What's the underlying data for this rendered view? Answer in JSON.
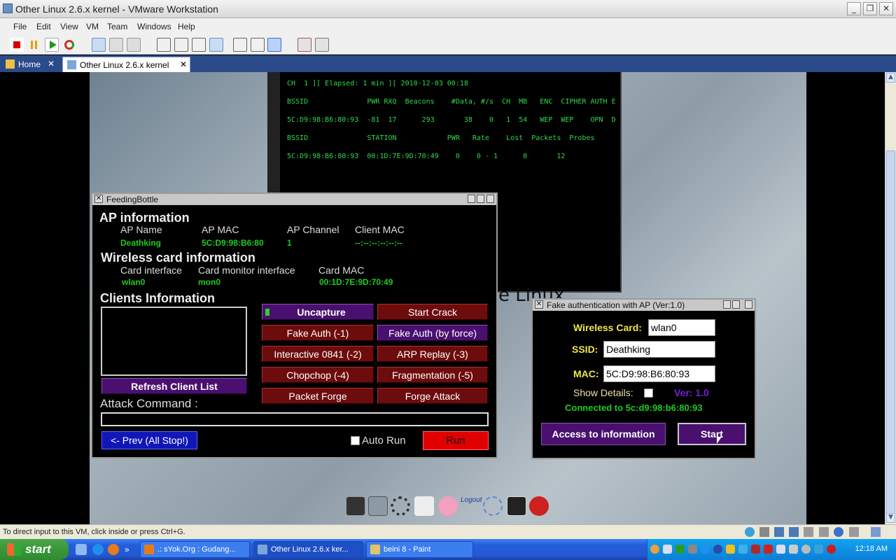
{
  "window": {
    "title": "Other Linux 2.6.x kernel - VMware Workstation"
  },
  "menu": [
    "File",
    "Edit",
    "View",
    "VM",
    "Team",
    "Windows",
    "Help"
  ],
  "tabs": [
    {
      "label": "Home"
    },
    {
      "label": "Other Linux 2.6.x kernel"
    }
  ],
  "terminal": {
    "lines": [
      "CH  1 ][ Elapsed: 1 min ][ 2010-12-03 00:18",
      "BSSID              PWR RXQ  Beacons    #Data, #/s  CH  MB   ENC  CIPHER AUTH E",
      "5C:D9:98:B6:80:93  -81  17      293       38    0   1  54   WEP  WEP    OPN  D",
      "BSSID              STATION            PWR   Rate    Lost  Packets  Probes",
      "5C:D9:98:B6:80:93  00:1D:7E:9D:70:49    0    0 - 1      0       12"
    ]
  },
  "background_text": "e Linux",
  "feedingbottle": {
    "title": "FeedingBottle",
    "ap_heading": "AP information",
    "ap_name_label": "AP Name",
    "ap_mac_label": "AP MAC",
    "ap_channel_label": "AP Channel",
    "client_mac_label": "Client MAC",
    "ap_name": "Deathking",
    "ap_mac": "5C:D9:98:B6:80",
    "ap_channel": "1",
    "client_mac": "--:--:--:--:--:--",
    "card_heading": "Wireless card information",
    "card_interface_label": "Card interface",
    "card_monitor_label": "Card monitor interface",
    "card_mac_label": "Card MAC",
    "card_interface": "wlan0",
    "card_monitor": "mon0",
    "card_mac": "00:1D:7E:9D:70:49",
    "clients_heading": "Clients Information",
    "refresh_label": "Refresh Client List",
    "uncapture_label": "Uncapture",
    "start_crack_label": "Start Crack",
    "fake_auth_label": "Fake Auth  (-1)",
    "fake_auth_force_label": "Fake Auth (by force)",
    "interactive_label": "Interactive 0841  (-2)",
    "arp_replay_label": "ARP Replay  (-3)",
    "chopchop_label": "Chopchop (-4)",
    "fragmentation_label": "Fragmentation (-5)",
    "packet_forge_label": "Packet Forge",
    "forge_attack_label": "Forge Attack",
    "attack_command_label": "Attack Command :",
    "attack_command_value": "",
    "prev_label": "<- Prev (All Stop!)",
    "auto_run_label": "Auto Run",
    "run_label": "Run"
  },
  "fakeauth": {
    "title": "Fake authentication with AP (Ver:1.0)",
    "wireless_card_label": "Wireless Card:",
    "wireless_card_value": "wlan0",
    "ssid_label": "SSID:",
    "ssid_value": "Deathking",
    "mac_label": "MAC:",
    "mac_value": "5C:D9:98:B6:80:93",
    "show_details_label": "Show Details:",
    "version_label": "Ver: 1.0",
    "connected_text": "Connected to 5c:d9:98:b6:80:93",
    "access_label": "Access to information",
    "start_label": "Start"
  },
  "status_bar": "To direct input to this VM, click inside or press Ctrl+G.",
  "taskbar": {
    "start_label": "start",
    "tasks": [
      ".: sYok.Org : Gudang...",
      "Other Linux 2.6.x ker...",
      "beini 8 - Paint"
    ],
    "clock": "12:18 AM"
  },
  "colors": {
    "term_green": "#2fd84e",
    "value_green": "#1ecc1e",
    "button_red": "#6d0c0c",
    "button_purple": "#4a1070",
    "run_red": "#e00000",
    "prev_blue": "#1016b8"
  }
}
